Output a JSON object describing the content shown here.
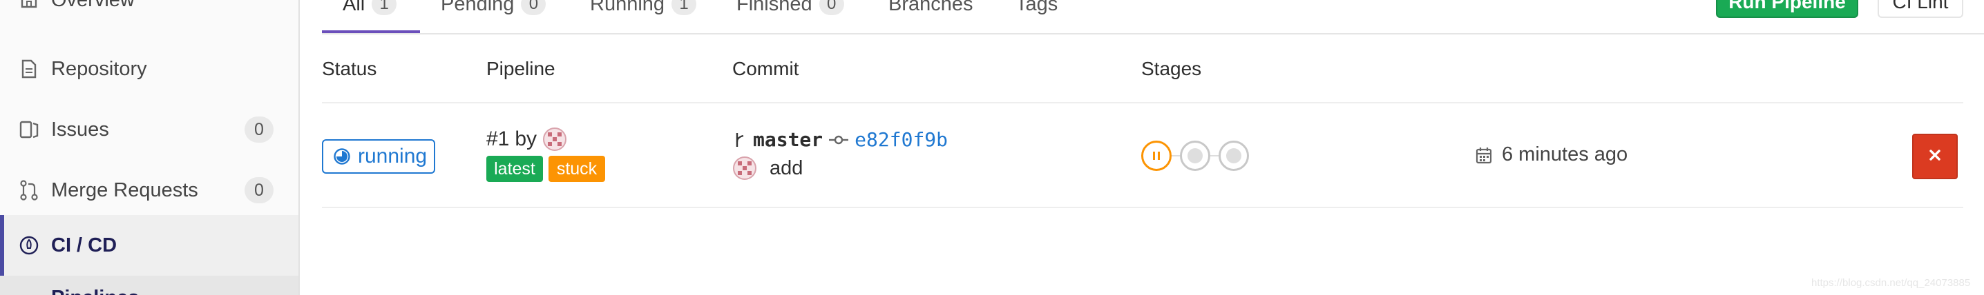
{
  "sidebar": {
    "items": [
      {
        "label": "Overview",
        "icon": "home-icon"
      },
      {
        "label": "Repository",
        "icon": "document-icon"
      },
      {
        "label": "Issues",
        "icon": "issues-icon",
        "count": "0"
      },
      {
        "label": "Merge Requests",
        "icon": "merge-request-icon",
        "count": "0"
      },
      {
        "label": "CI / CD",
        "icon": "rocket-icon",
        "active": true
      }
    ],
    "sub_item": {
      "label": "Pipelines"
    }
  },
  "tabs": [
    {
      "label": "All",
      "count": "1",
      "active": true
    },
    {
      "label": "Pending",
      "count": "0"
    },
    {
      "label": "Running",
      "count": "1"
    },
    {
      "label": "Finished",
      "count": "0"
    },
    {
      "label": "Branches"
    },
    {
      "label": "Tags"
    }
  ],
  "actions": {
    "run_pipeline": "Run Pipeline",
    "ci_lint": "CI Lint"
  },
  "table": {
    "headers": {
      "status": "Status",
      "pipeline": "Pipeline",
      "commit": "Commit",
      "stages": "Stages"
    },
    "rows": [
      {
        "status": "running",
        "pipeline_id": "#1",
        "by": "by",
        "tags": [
          "latest",
          "stuck"
        ],
        "ref": "master",
        "sha": "e82f0f9b",
        "commit_title": "add",
        "stages": [
          "running",
          "created",
          "created"
        ],
        "time": "6 minutes ago"
      }
    ]
  },
  "colors": {
    "running": "#1f78d1",
    "success": "#1aaa55",
    "warning": "#fc9403",
    "danger": "#db3b21",
    "active_nav": "#4b4ba3"
  },
  "watermark": "https://blog.csdn.net/qq_24073885"
}
